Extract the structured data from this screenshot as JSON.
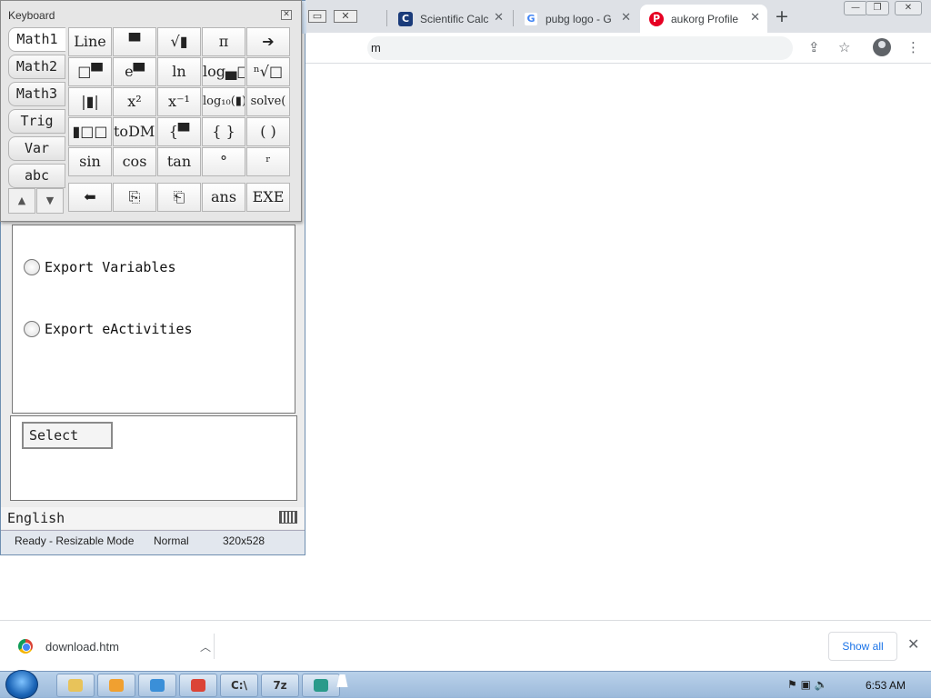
{
  "browser": {
    "tabs": [
      {
        "label": "Scientific Calc",
        "icon": "scientific-calc-icon",
        "color": "#1a3b7a",
        "glyph": "C"
      },
      {
        "label": "pubg logo - G",
        "icon": "google-icon",
        "color": "#4285f4",
        "glyph": "G"
      },
      {
        "label": "aukorg Profile",
        "icon": "pinterest-icon",
        "color": "#e60023",
        "glyph": "P"
      }
    ],
    "new_tab": "+",
    "address_fragment": "m"
  },
  "download_bar": {
    "file_name": "download.htm",
    "show_all": "Show all"
  },
  "classpad": {
    "keyboard_title": "Keyboard",
    "categories": [
      "Math1",
      "Math2",
      "Math3",
      "Trig",
      "Var",
      "abc"
    ],
    "selected_category": "Math1",
    "keys": [
      [
        "Line",
        "▀",
        "√▮",
        "π",
        "➔"
      ],
      [
        "□▀",
        "e▀",
        "ln",
        "log▄□",
        "ⁿ√□"
      ],
      [
        "|▮|",
        "x²",
        "x⁻¹",
        "log₁₀(▮)",
        "solve("
      ],
      [
        "▮□□",
        "toDMS",
        "{▀",
        "{ }",
        "( )"
      ],
      [
        "sin",
        "cos",
        "tan",
        "°",
        "ʳ"
      ],
      [
        "⬅",
        "⎘",
        "⎗",
        "ans",
        "EXE"
      ]
    ],
    "options": [
      "Export Variables",
      "Export eActivities"
    ],
    "select_button": "Select",
    "language": "English",
    "status": {
      "state": "Ready - Resizable Mode",
      "mode": "Normal",
      "size": "320x528"
    }
  },
  "taskbar": {
    "clock": "6:53 AM",
    "pinned": [
      "explorer-icon",
      "media-player-icon",
      "app-icon",
      "chrome-icon",
      "cmd-icon",
      "7zip-icon",
      "classpad-icon"
    ],
    "pinned_labels": [
      "",
      "",
      "",
      "",
      "C:\\",
      "7z",
      ""
    ]
  }
}
